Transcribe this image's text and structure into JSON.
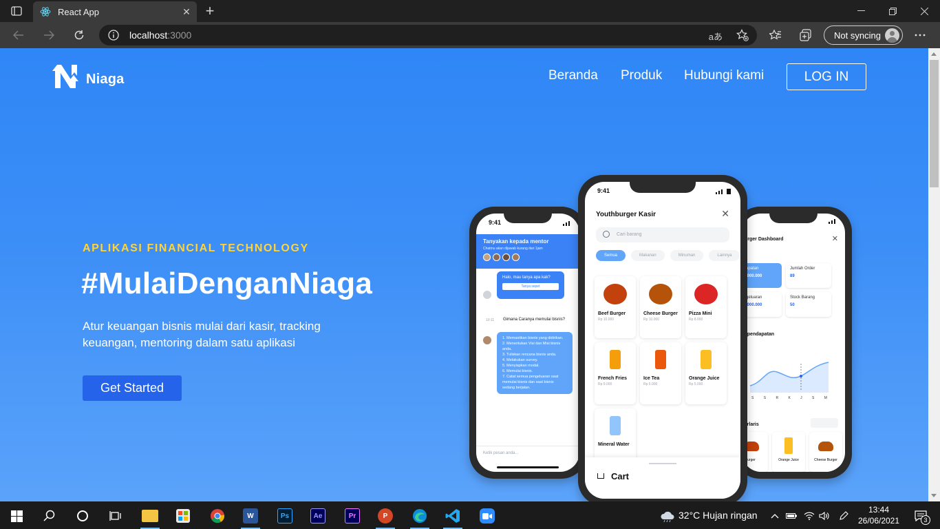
{
  "browser": {
    "tab_title": "React App",
    "url_host": "localhost",
    "url_port": ":3000",
    "profile_label": "Not syncing"
  },
  "site": {
    "brand": "Niaga",
    "nav": [
      "Beranda",
      "Produk",
      "Hubungi kami"
    ],
    "login_label": "LOG IN"
  },
  "hero": {
    "eyebrow": "APLIKASI FINANCIAL TECHNOLOGY",
    "title": "#MulaiDenganNiaga",
    "description": "Atur keuangan bisnis mulai dari kasir, tracking keuangan, mentoring dalam satu aplikasi",
    "cta": "Get Started"
  },
  "mockups": {
    "time": "9:41",
    "chat": {
      "header": "Tanyakan kepada mentor",
      "subheader": "Chatmu akan dijawab kurang dari 1jam",
      "bubble1": "Halo, mau tanya apa kak?",
      "bubble1_btn": "Tanya sepet",
      "time_label": "10:11",
      "question": "Gimana Caranya memulai bisnis?",
      "answer": [
        "1. Memastikan bisnis yang didirikan.",
        "2. Menentukan Visi dan Misi bisnis anda.",
        "3. Tuliskan rencana bisnis anda.",
        "4. Melakukan survey.",
        "5. Menyiapkan modal.",
        "6. Memulai bisnis.",
        "7. Catat semua pengeluaran saat memulai bisnis dan saat bisnis sedang berjalan."
      ],
      "input_placeholder": "Ketik pesan anda..."
    },
    "kasir": {
      "title": "Youthburger Kasir",
      "search_placeholder": "Cari barang",
      "chips": [
        "Semua",
        "Makanan",
        "Minuman",
        "Lainnya"
      ],
      "products": [
        {
          "name": "Beef Burger",
          "price": "Rp 10.000",
          "color": "#c2410c"
        },
        {
          "name": "Cheese Burger",
          "price": "Rp 10.000",
          "color": "#b45309"
        },
        {
          "name": "Pizza Mini",
          "price": "Rp 8.000",
          "color": "#dc2626"
        },
        {
          "name": "French Fries",
          "price": "Rp 9.000",
          "color": "#f59e0b"
        },
        {
          "name": "Ice Tea",
          "price": "Rp 5.000",
          "color": "#ea580c"
        },
        {
          "name": "Orange Juice",
          "price": "Rp 5.000",
          "color": "#fbbf24"
        },
        {
          "name": "Mineral Water",
          "price": "",
          "color": "#93c5fd"
        }
      ],
      "cart_label": "Cart"
    },
    "dashboard": {
      "title": "urger Dashboard",
      "stat1_label": "apatan",
      "stat1_value": ".000.000",
      "stat2_label": "Jumlah Order",
      "stat2_value": "89",
      "stat3_label": "geluaran",
      "stat3_value": ".000.000",
      "stat4_label": "Stock Barang",
      "stat4_value": "50",
      "chart_label": "ik pendapatan",
      "months": [
        "S",
        "S",
        "R",
        "K",
        "J",
        "S",
        "M"
      ],
      "best_label": "Terlaris",
      "best_items": [
        "urger",
        "Orange Juice",
        "Cheese Burger"
      ]
    }
  },
  "taskbar": {
    "weather": "32°C  Hujan ringan",
    "time": "13:44",
    "date": "26/06/2021",
    "notif_count": "3"
  }
}
